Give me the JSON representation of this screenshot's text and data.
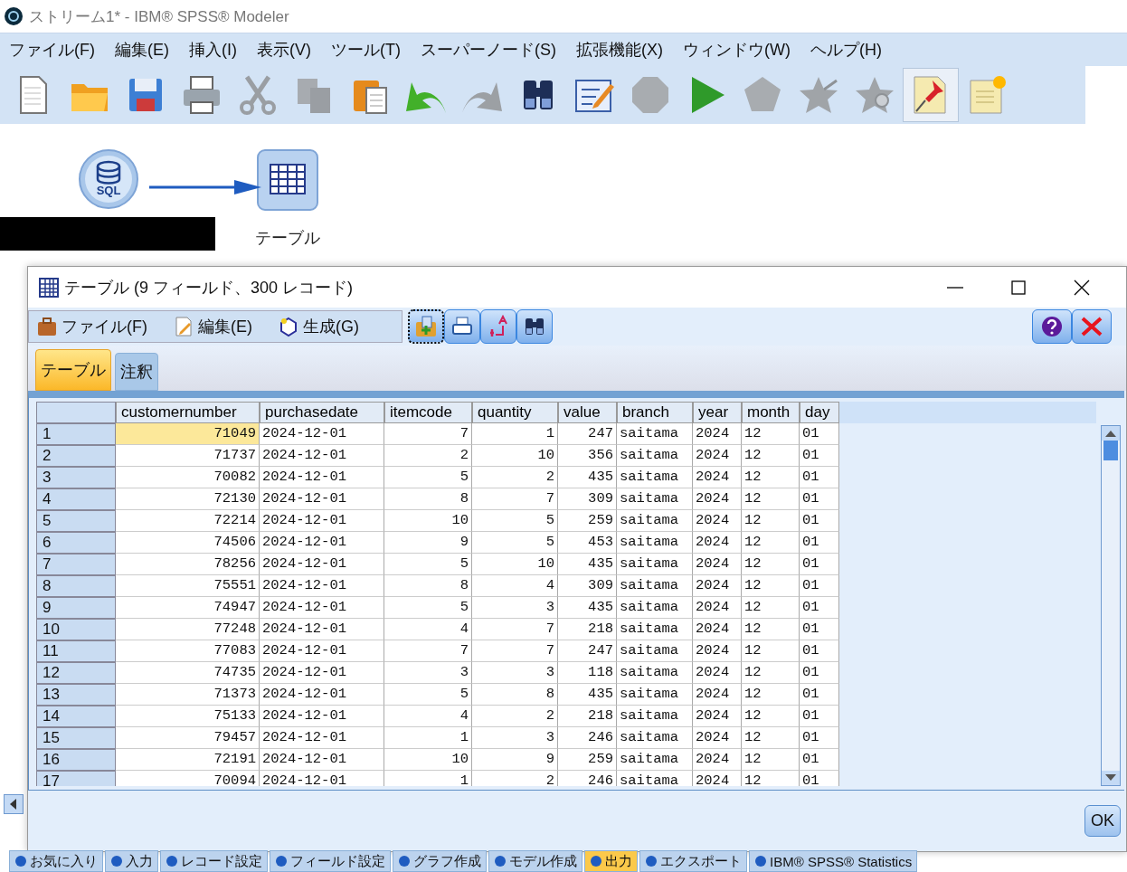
{
  "window": {
    "title": "ストリーム1* - IBM® SPSS® Modeler"
  },
  "menu": [
    "ファイル(F)",
    "編集(E)",
    "挿入(I)",
    "表示(V)",
    "ツール(T)",
    "スーパーノード(S)",
    "拡張機能(X)",
    "ウィンドウ(W)",
    "ヘルプ(H)"
  ],
  "toolbar": [
    {
      "kind": "new",
      "disabled": false,
      "pressed": false
    },
    {
      "kind": "open",
      "disabled": false,
      "pressed": false
    },
    {
      "kind": "save",
      "disabled": false,
      "pressed": false
    },
    {
      "kind": "print",
      "disabled": false,
      "pressed": false
    },
    {
      "kind": "cut",
      "disabled": true,
      "pressed": false
    },
    {
      "kind": "copy",
      "disabled": true,
      "pressed": false
    },
    {
      "kind": "paste",
      "disabled": false,
      "pressed": false
    },
    {
      "kind": "undo",
      "disabled": false,
      "pressed": false
    },
    {
      "kind": "redo",
      "disabled": true,
      "pressed": false
    },
    {
      "kind": "find",
      "disabled": false,
      "pressed": false
    },
    {
      "kind": "edit",
      "disabled": false,
      "pressed": false
    },
    {
      "kind": "stop",
      "disabled": true,
      "pressed": false
    },
    {
      "kind": "run",
      "disabled": false,
      "pressed": false
    },
    {
      "kind": "supernode",
      "disabled": true,
      "pressed": false
    },
    {
      "kind": "star",
      "disabled": true,
      "pressed": false
    },
    {
      "kind": "starzoom",
      "disabled": true,
      "pressed": false
    },
    {
      "kind": "pin",
      "disabled": false,
      "pressed": true
    },
    {
      "kind": "note",
      "disabled": false,
      "pressed": false
    }
  ],
  "canvas": {
    "nodes": [
      {
        "kind": "sql",
        "label": "SQL"
      },
      {
        "kind": "table",
        "label": "テーブル"
      }
    ]
  },
  "dialog": {
    "title": "テーブル (9 フィールド、300 レコード)",
    "menu": [
      "ファイル(F)",
      "編集(E)",
      "生成(G)"
    ],
    "tabs": [
      {
        "label": "テーブル",
        "selected": true
      },
      {
        "label": "注釈",
        "selected": false
      }
    ],
    "table": {
      "columns": [
        "customernumber",
        "purchasedate",
        "itemcode",
        "quantity",
        "value",
        "branch",
        "year",
        "month",
        "day"
      ],
      "rows": [
        {
          "n": "1",
          "selected": true,
          "cells": [
            "71049",
            "2024-12-01",
            "7",
            "1",
            "247",
            "saitama",
            "2024",
            "12",
            "01"
          ]
        },
        {
          "n": "2",
          "selected": false,
          "cells": [
            "71737",
            "2024-12-01",
            "2",
            "10",
            "356",
            "saitama",
            "2024",
            "12",
            "01"
          ]
        },
        {
          "n": "3",
          "selected": false,
          "cells": [
            "70082",
            "2024-12-01",
            "5",
            "2",
            "435",
            "saitama",
            "2024",
            "12",
            "01"
          ]
        },
        {
          "n": "4",
          "selected": false,
          "cells": [
            "72130",
            "2024-12-01",
            "8",
            "7",
            "309",
            "saitama",
            "2024",
            "12",
            "01"
          ]
        },
        {
          "n": "5",
          "selected": false,
          "cells": [
            "72214",
            "2024-12-01",
            "10",
            "5",
            "259",
            "saitama",
            "2024",
            "12",
            "01"
          ]
        },
        {
          "n": "6",
          "selected": false,
          "cells": [
            "74506",
            "2024-12-01",
            "9",
            "5",
            "453",
            "saitama",
            "2024",
            "12",
            "01"
          ]
        },
        {
          "n": "7",
          "selected": false,
          "cells": [
            "78256",
            "2024-12-01",
            "5",
            "10",
            "435",
            "saitama",
            "2024",
            "12",
            "01"
          ]
        },
        {
          "n": "8",
          "selected": false,
          "cells": [
            "75551",
            "2024-12-01",
            "8",
            "4",
            "309",
            "saitama",
            "2024",
            "12",
            "01"
          ]
        },
        {
          "n": "9",
          "selected": false,
          "cells": [
            "74947",
            "2024-12-01",
            "5",
            "3",
            "435",
            "saitama",
            "2024",
            "12",
            "01"
          ]
        },
        {
          "n": "10",
          "selected": false,
          "cells": [
            "77248",
            "2024-12-01",
            "4",
            "7",
            "218",
            "saitama",
            "2024",
            "12",
            "01"
          ]
        },
        {
          "n": "11",
          "selected": false,
          "cells": [
            "77083",
            "2024-12-01",
            "7",
            "7",
            "247",
            "saitama",
            "2024",
            "12",
            "01"
          ]
        },
        {
          "n": "12",
          "selected": false,
          "cells": [
            "74735",
            "2024-12-01",
            "3",
            "3",
            "118",
            "saitama",
            "2024",
            "12",
            "01"
          ]
        },
        {
          "n": "13",
          "selected": false,
          "cells": [
            "71373",
            "2024-12-01",
            "5",
            "8",
            "435",
            "saitama",
            "2024",
            "12",
            "01"
          ]
        },
        {
          "n": "14",
          "selected": false,
          "cells": [
            "75133",
            "2024-12-01",
            "4",
            "2",
            "218",
            "saitama",
            "2024",
            "12",
            "01"
          ]
        },
        {
          "n": "15",
          "selected": false,
          "cells": [
            "79457",
            "2024-12-01",
            "1",
            "3",
            "246",
            "saitama",
            "2024",
            "12",
            "01"
          ]
        },
        {
          "n": "16",
          "selected": false,
          "cells": [
            "72191",
            "2024-12-01",
            "10",
            "9",
            "259",
            "saitama",
            "2024",
            "12",
            "01"
          ]
        },
        {
          "n": "17",
          "selected": false,
          "cells": [
            "70094",
            "2024-12-01",
            "1",
            "2",
            "246",
            "saitama",
            "2024",
            "12",
            "01"
          ]
        }
      ]
    },
    "ok_button": "OK"
  },
  "palette": [
    {
      "label": "お気に入り",
      "selected": false
    },
    {
      "label": "入力",
      "selected": false
    },
    {
      "label": "レコード設定",
      "selected": false
    },
    {
      "label": "フィールド設定",
      "selected": false
    },
    {
      "label": "グラフ作成",
      "selected": false
    },
    {
      "label": "モデル作成",
      "selected": false
    },
    {
      "label": "出力",
      "selected": true
    },
    {
      "label": "エクスポート",
      "selected": false
    },
    {
      "label": "IBM® SPSS® Statistics",
      "selected": false
    }
  ]
}
